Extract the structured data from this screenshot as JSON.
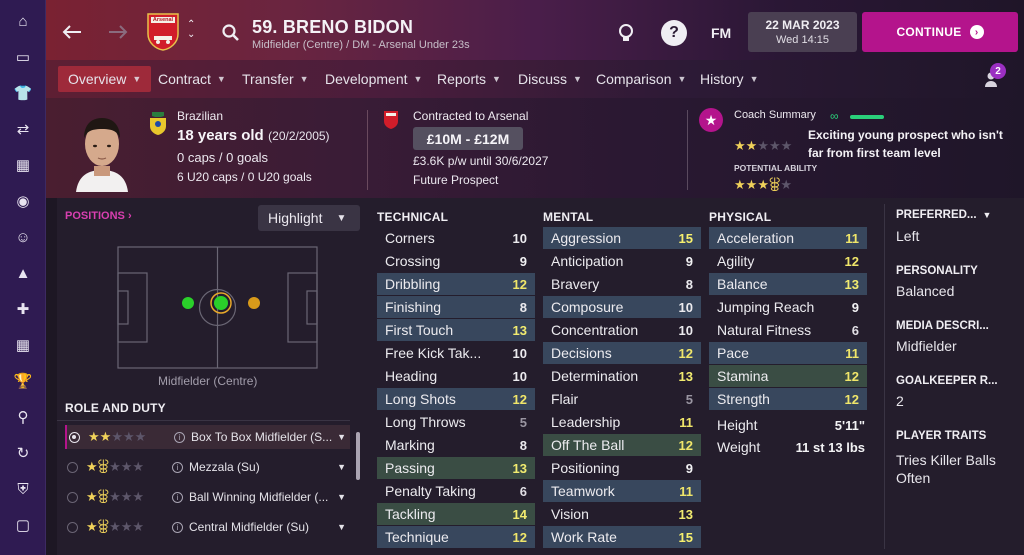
{
  "colors": {
    "accent": "#b4148c",
    "active_tab": "#9e2a3a",
    "highlight_row": "#3a4a5f"
  },
  "sidebar": {
    "icons": [
      "home-icon",
      "inbox-icon",
      "squad-icon",
      "transfers-icon",
      "tactics-icon",
      "scouting-icon",
      "staff-icon",
      "training-icon",
      "medical-icon",
      "schedule-icon",
      "trophy-icon",
      "search-icon",
      "refresh-icon",
      "club-shield-icon",
      "briefcase-icon"
    ]
  },
  "header": {
    "player_name": "59. BRENO BIDON",
    "subtitle": "Midfielder (Centre) / DM - Arsenal Under 23s",
    "date": "22 MAR 2023",
    "time": "Wed 14:15",
    "continue_label": "CONTINUE",
    "fm_label": "FM",
    "crest_text": "Arsenal"
  },
  "tabs": [
    {
      "label": "Overview"
    },
    {
      "label": "Contract"
    },
    {
      "label": "Transfer"
    },
    {
      "label": "Development"
    },
    {
      "label": "Reports"
    },
    {
      "label": "Discuss"
    },
    {
      "label": "Comparison"
    },
    {
      "label": "History"
    }
  ],
  "notifications": {
    "count": "2"
  },
  "profile": {
    "nationality": "Brazilian",
    "age": "18 years old",
    "dob": "(20/2/2005)",
    "caps": "0 caps / 0 goals",
    "u20": "6 U20 caps / 0 U20 goals",
    "contract_to": "Contracted to Arsenal",
    "value": "£10M - £12M",
    "wage": "£3.6K p/w until 30/6/2027",
    "status": "Future Prospect",
    "coach_label": "Coach Summary",
    "coach_text": "Exciting young prospect who isn't far from first team level",
    "potential_label": "POTENTIAL ABILITY",
    "current_stars": 2,
    "potential_stars": 3.5
  },
  "positions": {
    "label": "POSITIONS",
    "highlight": "Highlight",
    "caption": "Midfielder (Centre)"
  },
  "roles": {
    "title": "ROLE AND DUTY",
    "items": [
      {
        "label": "Box To Box Midfielder (S...",
        "stars": 2
      },
      {
        "label": "Mezzala (Su)",
        "stars": 1.5
      },
      {
        "label": "Ball Winning Midfielder (...",
        "stars": 1.5
      },
      {
        "label": "Central Midfielder (Su)",
        "stars": 1.5
      }
    ]
  },
  "technical": {
    "title": "TECHNICAL",
    "items": [
      [
        "Corners",
        "10"
      ],
      [
        "Crossing",
        "9"
      ],
      [
        "Dribbling",
        "12"
      ],
      [
        "Finishing",
        "8"
      ],
      [
        "First Touch",
        "13"
      ],
      [
        "Free Kick Tak...",
        "10"
      ],
      [
        "Heading",
        "10"
      ],
      [
        "Long Shots",
        "12"
      ],
      [
        "Long Throws",
        "5"
      ],
      [
        "Marking",
        "8"
      ],
      [
        "Passing",
        "13"
      ],
      [
        "Penalty Taking",
        "6"
      ],
      [
        "Tackling",
        "14"
      ],
      [
        "Technique",
        "12"
      ]
    ]
  },
  "mental": {
    "title": "MENTAL",
    "items": [
      [
        "Aggression",
        "15"
      ],
      [
        "Anticipation",
        "9"
      ],
      [
        "Bravery",
        "8"
      ],
      [
        "Composure",
        "10"
      ],
      [
        "Concentration",
        "10"
      ],
      [
        "Decisions",
        "12"
      ],
      [
        "Determination",
        "13"
      ],
      [
        "Flair",
        "5"
      ],
      [
        "Leadership",
        "11"
      ],
      [
        "Off The Ball",
        "12"
      ],
      [
        "Positioning",
        "9"
      ],
      [
        "Teamwork",
        "11"
      ],
      [
        "Vision",
        "13"
      ],
      [
        "Work Rate",
        "15"
      ]
    ]
  },
  "physical": {
    "title": "PHYSICAL",
    "items": [
      [
        "Acceleration",
        "11"
      ],
      [
        "Agility",
        "12"
      ],
      [
        "Balance",
        "13"
      ],
      [
        "Jumping Reach",
        "9"
      ],
      [
        "Natural Fitness",
        "6"
      ],
      [
        "Pace",
        "11"
      ],
      [
        "Stamina",
        "12"
      ],
      [
        "Strength",
        "12"
      ]
    ],
    "height_label": "Height",
    "height": "5'11\"",
    "weight_label": "Weight",
    "weight": "11 st 13 lbs"
  },
  "info": {
    "preferred_label": "PREFERRED...",
    "preferred": "Left",
    "personality_label": "PERSONALITY",
    "personality": "Balanced",
    "media_label": "MEDIA DESCRI...",
    "media": "Midfielder",
    "gk_label": "GOALKEEPER R...",
    "gk": "2",
    "traits_label": "PLAYER TRAITS",
    "traits": "Tries Killer Balls Often"
  }
}
